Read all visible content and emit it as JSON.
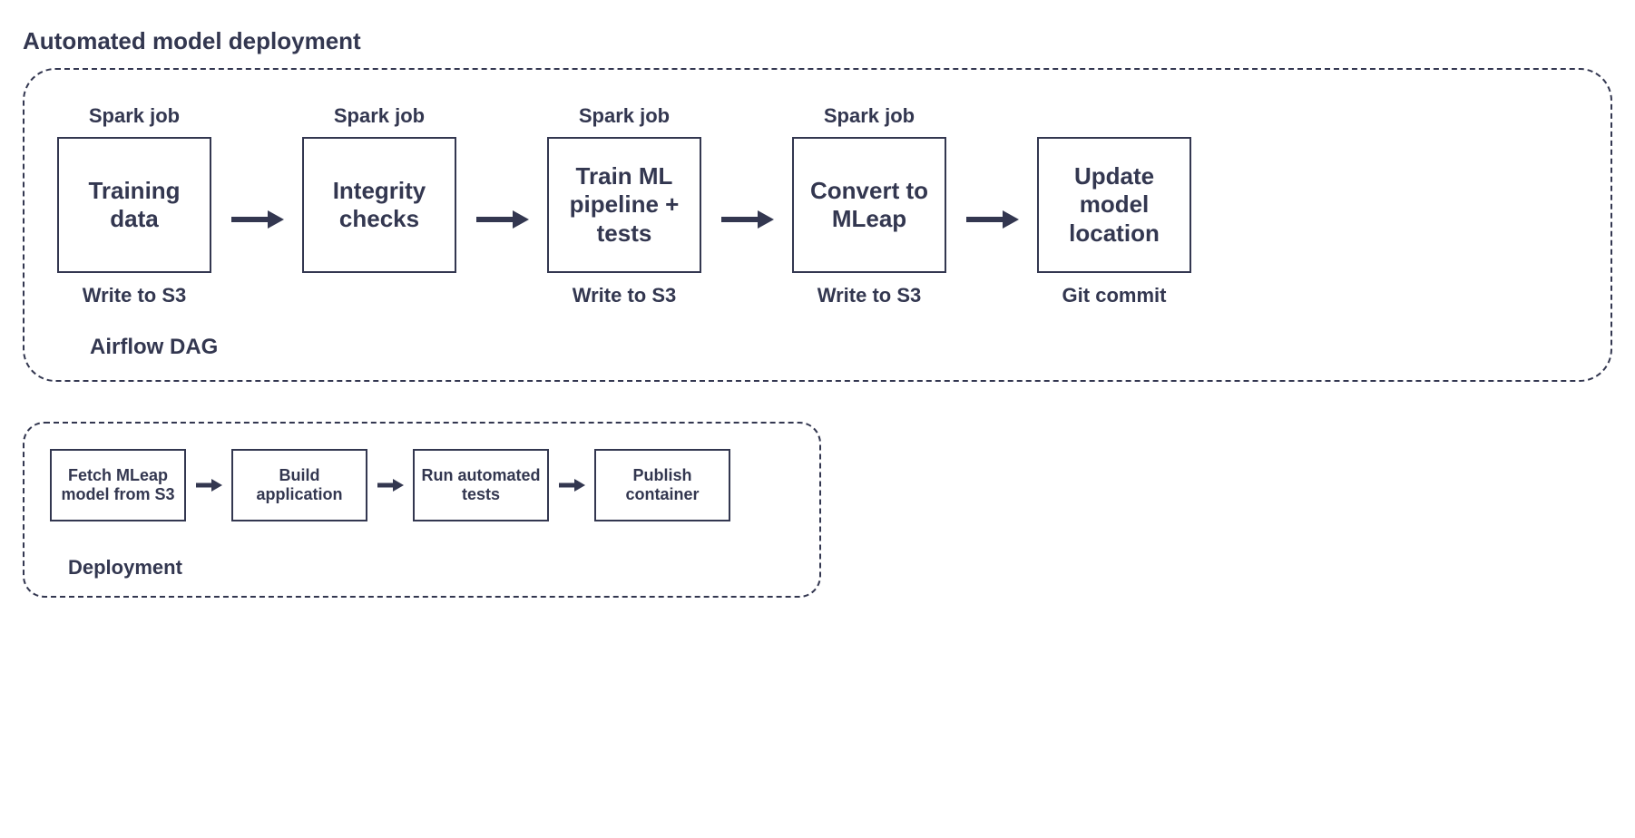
{
  "title": "Automated model deployment",
  "colors": {
    "ink": "#333750"
  },
  "airflow": {
    "footer": "Airflow DAG",
    "steps": [
      {
        "above": "Spark job",
        "label": "Training data",
        "below": "Write to S3"
      },
      {
        "above": "Spark job",
        "label": "Integrity checks",
        "below": ""
      },
      {
        "above": "Spark job",
        "label": "Train ML pipeline + tests",
        "below": "Write to S3"
      },
      {
        "above": "Spark job",
        "label": "Convert to MLeap",
        "below": "Write to S3"
      },
      {
        "above": "",
        "label": "Update model location",
        "below": "Git commit"
      }
    ]
  },
  "deployment": {
    "footer": "Deployment",
    "steps": [
      {
        "label": "Fetch MLeap model from S3"
      },
      {
        "label": "Build application"
      },
      {
        "label": "Run automated tests"
      },
      {
        "label": "Publish container"
      }
    ]
  }
}
